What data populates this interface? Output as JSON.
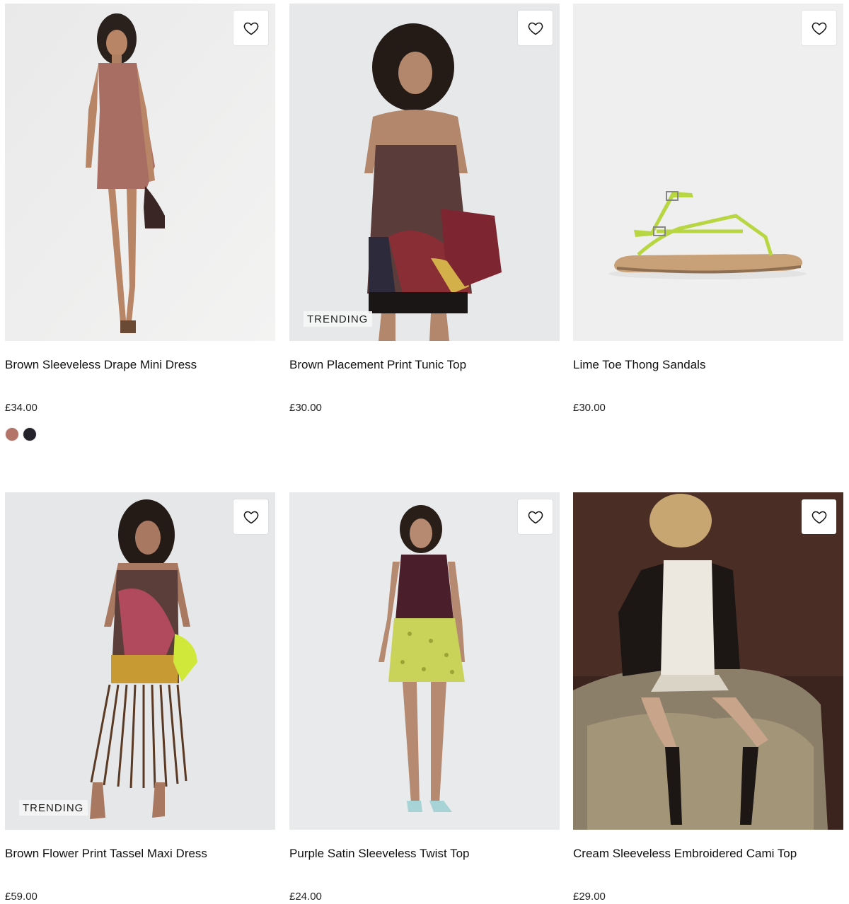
{
  "products": [
    {
      "title": "Brown Sleeveless Drape Mini Dress",
      "price": "£34.00",
      "badge": "",
      "swatches": [
        "#b47468",
        "#26222c"
      ],
      "image_icon": "model-mini-dress-image"
    },
    {
      "title": "Brown Placement Print Tunic Top",
      "price": "£30.00",
      "badge": "TRENDING",
      "swatches": [],
      "image_icon": "model-tunic-top-image"
    },
    {
      "title": "Lime Toe Thong Sandals",
      "price": "£30.00",
      "badge": "",
      "swatches": [],
      "image_icon": "sandal-image"
    },
    {
      "title": "Brown Flower Print Tassel Maxi Dress",
      "price": "£59.00",
      "badge": "TRENDING",
      "swatches": [],
      "image_icon": "model-maxi-dress-image"
    },
    {
      "title": "Purple Satin Sleeveless Twist Top",
      "price": "£24.00",
      "badge": "",
      "swatches": [],
      "image_icon": "model-twist-top-image"
    },
    {
      "title": "Cream Sleeveless Embroidered Cami Top",
      "price": "£29.00",
      "badge": "",
      "swatches": [],
      "image_icon": "model-cami-top-image"
    }
  ],
  "wishlist_icon": "heart-outline-icon"
}
